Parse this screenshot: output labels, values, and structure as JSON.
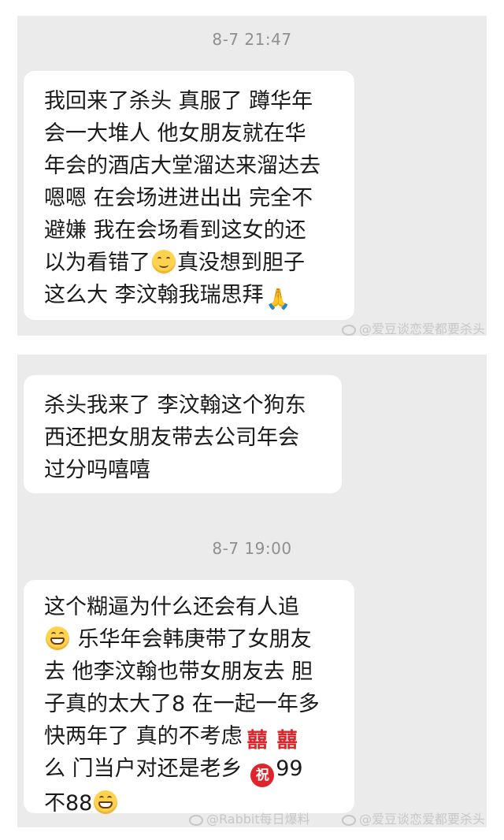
{
  "conversation_1": {
    "timestamp": "8-7 21:47",
    "message_lines": [
      "我回来了杀头 真服了 蹲华年",
      "会一大堆人 他女朋友就在华",
      "年会的酒店大堂溜达来溜达去",
      "嗯嗯 在会场进进出出 完全不",
      "避嫌 我在会场看到这女的还",
      "以为看错了",
      "真没想到胆子",
      "这么大 李汶翰我瑞思拜"
    ],
    "watermark": "@爱豆谈恋爱都要杀头",
    "emoji": [
      "smile-emoji",
      "pray-hands-emoji"
    ]
  },
  "conversation_2": {
    "message_a_lines": [
      "杀头我来了 李汶翰这个狗东",
      "西还把女朋友带去公司年会",
      "过分吗嘻嘻"
    ],
    "timestamp": "8-7 19:00",
    "message_b_lines": [
      "这个糊逼为什么还会有人追",
      "乐华年会韩庚带了女朋友",
      "去 他李汶翰也带女朋友去 胆",
      "子真的太大了8 在一起一年多",
      "快两年了 真的不考虑",
      "么 门当户对还是老乡",
      "99",
      "不88"
    ],
    "emoji_text": {
      "double_happiness": "囍",
      "congrats": "祝"
    },
    "watermarks": [
      "@Rabbit每日爆料",
      "@爱豆谈恋爱都要杀头"
    ]
  }
}
